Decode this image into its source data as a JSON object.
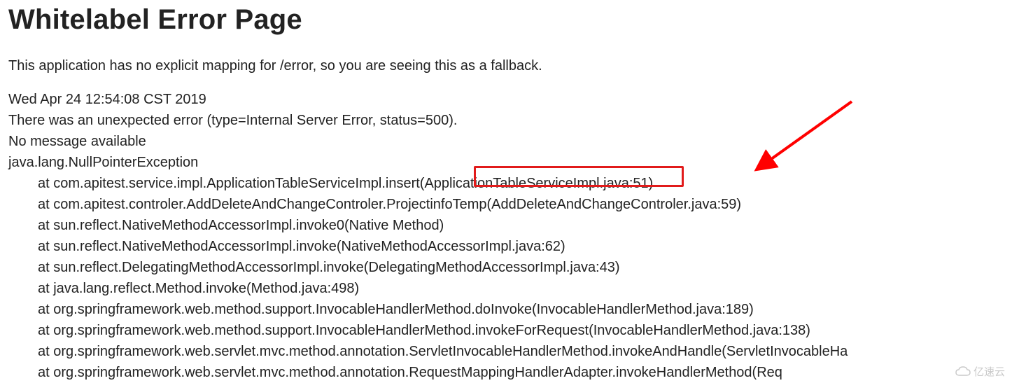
{
  "title": "Whitelabel Error Page",
  "fallback_msg": "This application has no explicit mapping for /error, so you are seeing this as a fallback.",
  "timestamp": "Wed Apr 24 12:54:08 CST 2019",
  "error_line": "There was an unexpected error (type=Internal Server Error, status=500).",
  "no_message": "No message available",
  "exception": "java.lang.NullPointerException",
  "stack": [
    "at com.apitest.service.impl.ApplicationTableServiceImpl.insert(ApplicationTableServiceImpl.java:51)",
    "at com.apitest.controler.AddDeleteAndChangeControler.ProjectinfoTemp(AddDeleteAndChangeControler.java:59)",
    "at sun.reflect.NativeMethodAccessorImpl.invoke0(Native Method)",
    "at sun.reflect.NativeMethodAccessorImpl.invoke(NativeMethodAccessorImpl.java:62)",
    "at sun.reflect.DelegatingMethodAccessorImpl.invoke(DelegatingMethodAccessorImpl.java:43)",
    "at java.lang.reflect.Method.invoke(Method.java:498)",
    "at org.springframework.web.method.support.InvocableHandlerMethod.doInvoke(InvocableHandlerMethod.java:189)",
    "at org.springframework.web.method.support.InvocableHandlerMethod.invokeForRequest(InvocableHandlerMethod.java:138)",
    "at org.springframework.web.servlet.mvc.method.annotation.ServletInvocableHandlerMethod.invokeAndHandle(ServletInvocableHa",
    "at org.springframework.web.servlet.mvc.method.annotation.RequestMappingHandlerAdapter.invokeHandlerMethod(Req"
  ],
  "highlight": {
    "text_fragment": "(ApplicationTableService",
    "color": "#e11b1b"
  },
  "watermark": "亿速云"
}
